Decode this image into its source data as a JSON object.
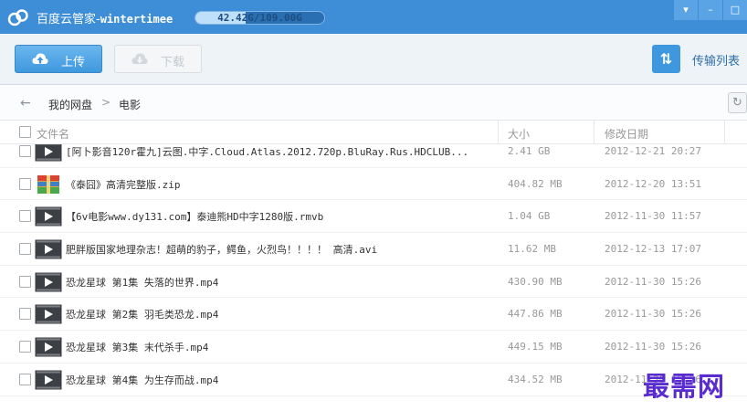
{
  "app": {
    "title": "百度云管家-",
    "account": "wintertimee",
    "quota_text": "42.42G/109.00G",
    "quota_used_fraction": 0.389
  },
  "window_buttons": [
    "▾",
    "–",
    "□"
  ],
  "toolbar": {
    "upload_label": "上传",
    "download_label": "下载",
    "transfer_label": "传输列表",
    "transfer_icon": "⇅"
  },
  "breadcrumb": {
    "back": "←",
    "root": "我的网盘",
    "separator": ">",
    "current": "电影",
    "refresh": "↻"
  },
  "columns": {
    "name": "文件名",
    "size": "大小",
    "date": "修改日期"
  },
  "files": [
    {
      "icon": "video-file-icon",
      "name": "[阿卜影音120r霍九]云图.中字.Cloud.Atlas.2012.720p.BluRay.Rus.HDCLUB...",
      "size": "2.41 GB",
      "date": "2012-12-21 20:27"
    },
    {
      "icon": "archive-file-icon",
      "name": "《泰囧》高清完整版.zip",
      "size": "404.82 MB",
      "date": "2012-12-20 13:51"
    },
    {
      "icon": "video-file-icon",
      "name": "【6v电影www.dy131.com】泰迪熊HD中字1280版.rmvb",
      "size": "1.04 GB",
      "date": "2012-11-30 11:57"
    },
    {
      "icon": "video-file-icon",
      "name": "肥胖版国家地理杂志！超萌的豹子，鳄鱼，火烈鸟！！！！ 高清.avi",
      "size": "11.62 MB",
      "date": "2012-12-13 17:07"
    },
    {
      "icon": "video-file-icon",
      "name": "恐龙星球 第1集 失落的世界.mp4",
      "size": "430.90 MB",
      "date": "2012-11-30 15:26"
    },
    {
      "icon": "video-file-icon",
      "name": "恐龙星球 第2集 羽毛类恐龙.mp4",
      "size": "447.86 MB",
      "date": "2012-11-30 15:26"
    },
    {
      "icon": "video-file-icon",
      "name": "恐龙星球 第3集 末代杀手.mp4",
      "size": "449.15 MB",
      "date": "2012-11-30 15:26"
    },
    {
      "icon": "video-file-icon",
      "name": "恐龙星球 第4集 为生存而战.mp4",
      "size": "434.52 MB",
      "date": "2012-11-30 15:26"
    }
  ],
  "watermark": "最需网",
  "colors": {
    "titlebar": "#3d8ed7",
    "accent": "#3f98de",
    "watermark": "#5a2bd1"
  }
}
